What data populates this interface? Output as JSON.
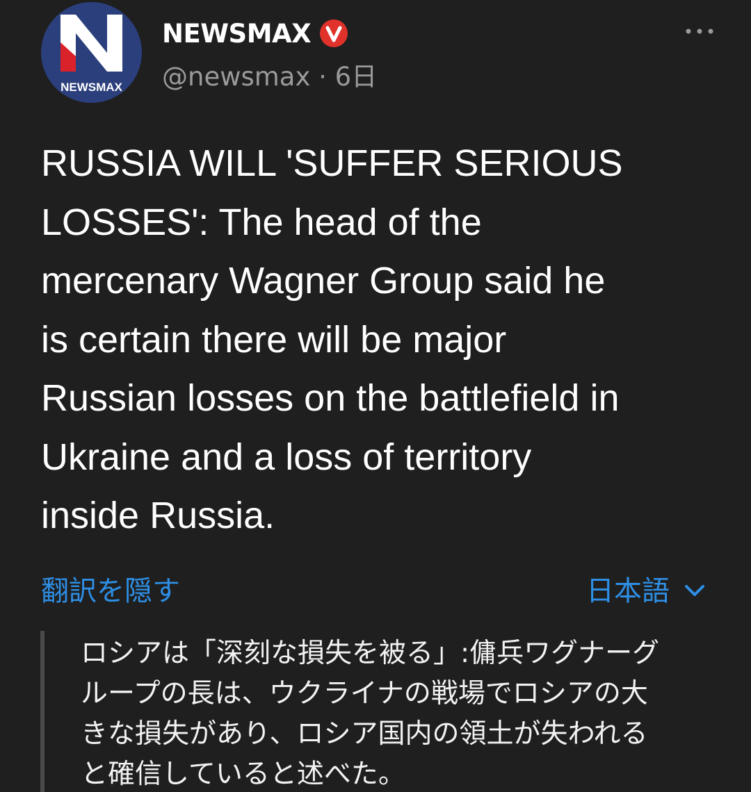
{
  "tweet": {
    "author": {
      "avatar_logo_text": "NEWSMAX",
      "display_name": "NEWSMAX",
      "handle": "@newsmax",
      "separator": "·",
      "time": "6日",
      "verified_icon": "verified-badge-icon"
    },
    "more_icon": "more-options-icon",
    "text": "RUSSIA WILL 'SUFFER SERIOUS\nLOSSES': The head of the\nmercenary Wagner Group said he\nis certain there will be major\nRussian losses on the battlefield in\nUkraine and a loss of territory\ninside Russia.",
    "translation": {
      "hide_label": "翻訳を隠す",
      "language_label": "日本語",
      "language_icon": "chevron-down-icon",
      "text": "ロシアは「深刻な損失を被る」:傭兵ワグナーグ\nループの長は、ウクライナの戦場でロシアの大\nきな損失があり、ロシア国内の領土が失われる\nと確信していると述べた。"
    }
  },
  "colors": {
    "background": "#1f1f1f",
    "link": "#2e8fe6",
    "secondary_text": "#9a9a9a",
    "verified_badge": "#e0322b"
  }
}
